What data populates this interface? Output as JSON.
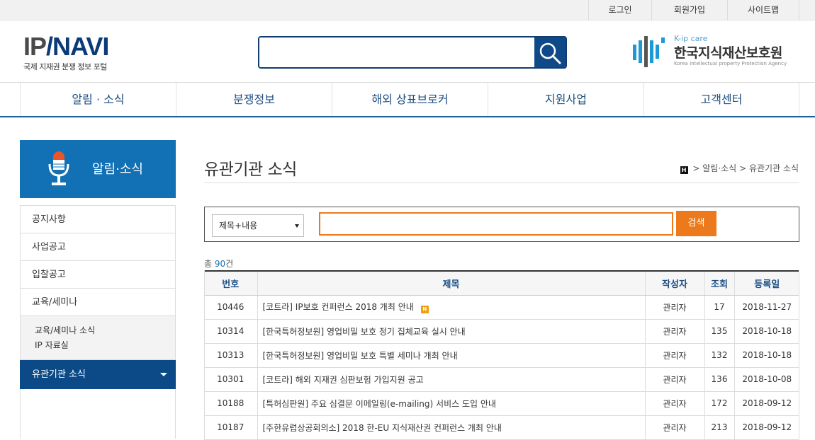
{
  "util_links": [
    "로그인",
    "회원가입",
    "사이트맵"
  ],
  "logo": {
    "ip": "IP",
    "navi": "NAVI",
    "tagline": "국제 지재권 분쟁 정보 포털"
  },
  "search": {
    "value": ""
  },
  "agency": {
    "sub": "K-ip care",
    "name": "한국지식재산보호원",
    "eng": "Korea Intellectual property Protection Agency"
  },
  "gnb": [
    "알림 · 소식",
    "분쟁정보",
    "해외 상표브로커",
    "지원사업",
    "고객센터"
  ],
  "sidebar": {
    "title": "알림·소식",
    "items": [
      "공지사항",
      "사업공고",
      "입찰공고",
      "교육/세미나"
    ],
    "sub_items": [
      "교육/세미나 소식",
      "IP 자료실"
    ],
    "active": "유관기관 소식"
  },
  "page": {
    "title": "유관기관 소식",
    "breadcrumb": [
      "알림·소식",
      "유관기관 소식"
    ]
  },
  "filter": {
    "select_value": "제목+내용",
    "keyword": "",
    "button": "검색"
  },
  "total": {
    "prefix": "총",
    "count": "90",
    "suffix": "건"
  },
  "table": {
    "headers": [
      "번호",
      "제목",
      "작성자",
      "조회",
      "등록일"
    ],
    "rows": [
      {
        "no": "10446",
        "title": "[코트라] IP보호 컨퍼런스 2018 개최 안내",
        "new": "N",
        "author": "관리자",
        "views": "17",
        "date": "2018-11-27"
      },
      {
        "no": "10314",
        "title": "[한국특허정보원] 영업비밀 보호 정기 집체교육 실시 안내",
        "author": "관리자",
        "views": "135",
        "date": "2018-10-18"
      },
      {
        "no": "10313",
        "title": "[한국특허정보원] 영업비밀 보호 특별 세미나 개최 안내",
        "author": "관리자",
        "views": "132",
        "date": "2018-10-18"
      },
      {
        "no": "10301",
        "title": "[코트라] 해외 지재권 심판보험 가입지원 공고",
        "author": "관리자",
        "views": "136",
        "date": "2018-10-08"
      },
      {
        "no": "10188",
        "title": "[특허심판원] 주요 심결문 이메일링(e-mailing) 서비스 도입 안내",
        "author": "관리자",
        "views": "172",
        "date": "2018-09-12"
      },
      {
        "no": "10187",
        "title": "[주한유럽상공회의소] 2018 한-EU 지식재산권 컨퍼런스 개최 안내",
        "author": "관리자",
        "views": "213",
        "date": "2018-09-12"
      }
    ]
  }
}
